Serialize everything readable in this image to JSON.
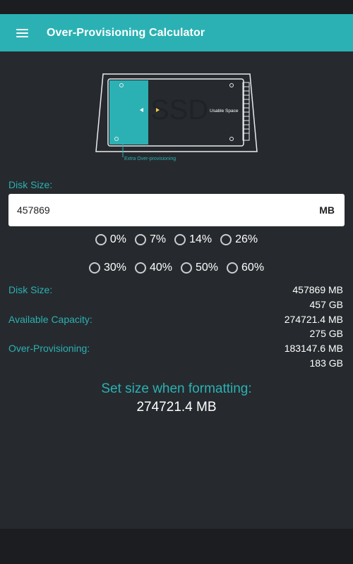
{
  "app": {
    "title": "Over-Provisioning Calculator"
  },
  "diagram": {
    "ssd_text": "SSD",
    "usable_label": "Usable Space",
    "extra_label": "Extra Over-provisioning"
  },
  "form": {
    "disk_size_label": "Disk Size:",
    "disk_size_value": "457869",
    "unit": "MB"
  },
  "percent_options_row1": [
    "0%",
    "7%",
    "14%",
    "26%"
  ],
  "percent_options_row2": [
    "30%",
    "40%",
    "50%",
    "60%"
  ],
  "results": {
    "disk_size_label": "Disk Size:",
    "disk_size_mb": "457869 MB",
    "disk_size_gb": "457 GB",
    "available_label": "Available Capacity:",
    "available_mb": "274721.4 MB",
    "available_gb": "275 GB",
    "op_label": "Over-Provisioning:",
    "op_mb": "183147.6 MB",
    "op_gb": "183 GB"
  },
  "format": {
    "label": "Set size when formatting:",
    "value": "274721.4 MB"
  },
  "colors": {
    "accent": "#2bb1b3",
    "background": "#262a2e",
    "appbar": "#2bb1b3",
    "text": "#ffffff"
  }
}
